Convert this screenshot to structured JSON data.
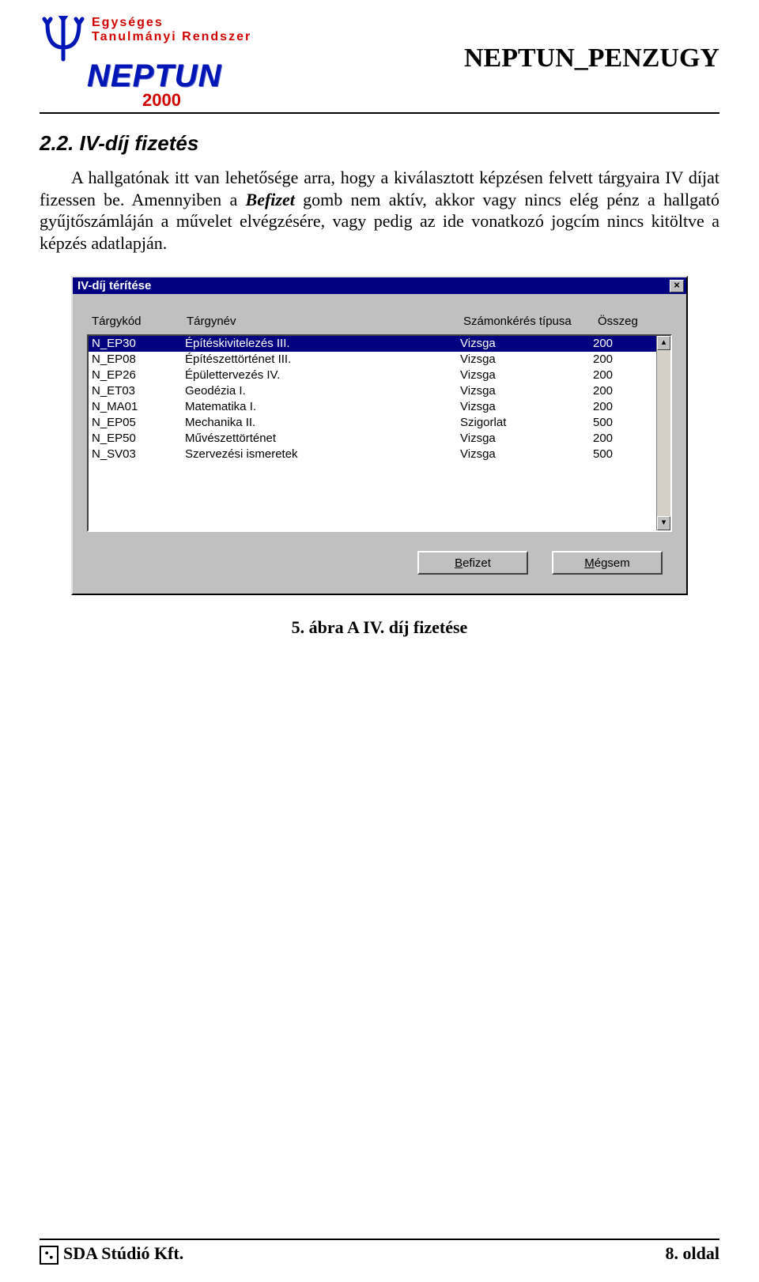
{
  "header": {
    "tagline_line1": "Egységes",
    "tagline_line2": "Tanulmányi  Rendszer",
    "logo_word": "NEPTUN",
    "logo_year": "2000",
    "doc_title": "NEPTUN_PENZUGY"
  },
  "section": {
    "heading": "2.2. IV-díj fizetés",
    "paragraph_a": "A hallgatónak itt van lehetősége arra, hogy a kiválasztott képzésen felvett tárgyaira IV díjat fizessen be. Amennyiben a ",
    "paragraph_befizet": "Befizet",
    "paragraph_b": " gomb nem aktív, akkor vagy nincs elég pénz a hallgató gyűjtőszámláján a művelet elvégzésére, vagy pedig az ide vonatkozó jogcím nincs kitöltve a képzés adatlapján."
  },
  "dialog": {
    "title": "IV-díj térítése",
    "close_glyph": "×",
    "columns": [
      "Tárgykód",
      "Tárgynév",
      "Számonkérés típusa",
      "Összeg"
    ],
    "rows": [
      {
        "code": "N_EP30",
        "name": "Építéskivitelezés III.",
        "type": "Vizsga",
        "amount": "200",
        "selected": true
      },
      {
        "code": "N_EP08",
        "name": "Építészettörténet III.",
        "type": "Vizsga",
        "amount": "200",
        "selected": false
      },
      {
        "code": "N_EP26",
        "name": "Épülettervezés IV.",
        "type": "Vizsga",
        "amount": "200",
        "selected": false
      },
      {
        "code": "N_ET03",
        "name": "Geodézia I.",
        "type": "Vizsga",
        "amount": "200",
        "selected": false
      },
      {
        "code": "N_MA01",
        "name": "Matematika I.",
        "type": "Vizsga",
        "amount": "200",
        "selected": false
      },
      {
        "code": "N_EP05",
        "name": "Mechanika II.",
        "type": "Szigorlat",
        "amount": "500",
        "selected": false
      },
      {
        "code": "N_EP50",
        "name": "Művészettörténet",
        "type": "Vizsga",
        "amount": "200",
        "selected": false
      },
      {
        "code": "N_SV03",
        "name": "Szervezési ismeretek",
        "type": "Vizsga",
        "amount": "500",
        "selected": false
      }
    ],
    "scroll_up": "▴",
    "scroll_down": "▾",
    "btn_befizet_pre": "",
    "btn_befizet_ul": "B",
    "btn_befizet_post": "efizet",
    "btn_megsem_pre": "",
    "btn_megsem_ul": "M",
    "btn_megsem_post": "égsem"
  },
  "caption": "5. ábra A IV. díj fizetése",
  "footer": {
    "company": "SDA Stúdió Kft.",
    "page": "8. oldal"
  }
}
